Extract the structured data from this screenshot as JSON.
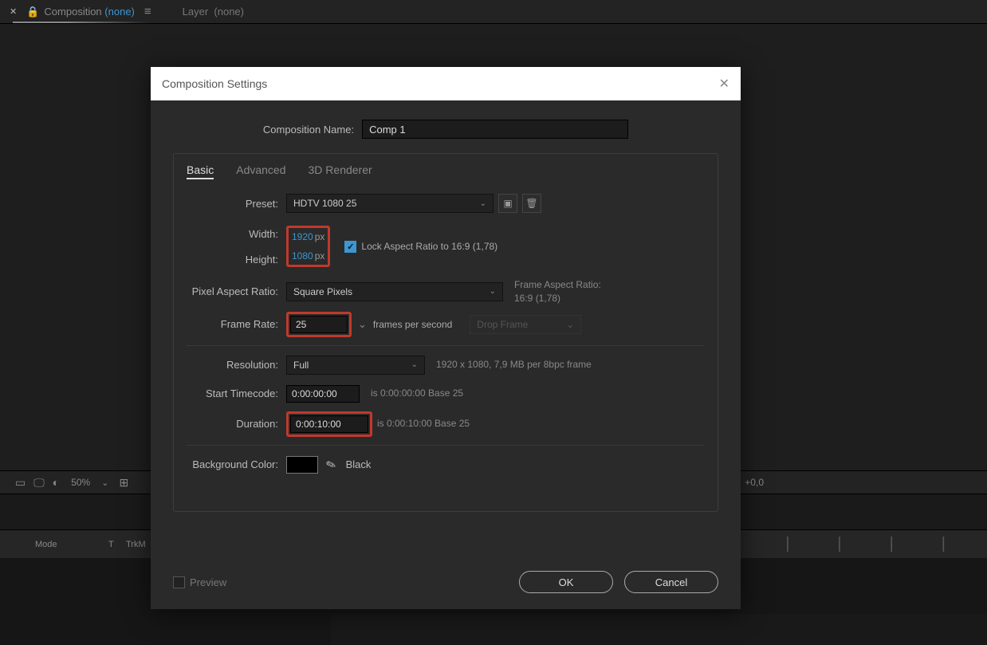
{
  "topbar": {
    "composition_label": "Composition",
    "composition_none": "(none)",
    "layer_label": "Layer",
    "layer_none": "(none)"
  },
  "toolbar": {
    "zoom": "50%",
    "plus_zero": "+0,0"
  },
  "timeline": {
    "mode": "Mode",
    "t": "T",
    "trkm": "TrkM"
  },
  "dialog": {
    "title": "Composition Settings",
    "comp_name_label": "Composition Name:",
    "comp_name": "Comp 1",
    "tabs": {
      "basic": "Basic",
      "advanced": "Advanced",
      "renderer": "3D Renderer"
    },
    "preset_label": "Preset:",
    "preset_value": "HDTV 1080 25",
    "width_label": "Width:",
    "width_value": "1920",
    "width_unit": "px",
    "height_label": "Height:",
    "height_value": "1080",
    "height_unit": "px",
    "lock_label": "Lock Aspect Ratio to 16:9 (1,78)",
    "par_label": "Pixel Aspect Ratio:",
    "par_value": "Square Pixels",
    "far_label": "Frame Aspect Ratio:",
    "far_value": "16:9 (1,78)",
    "fps_label": "Frame Rate:",
    "fps_value": "25",
    "fps_text": "frames per second",
    "drop_frame": "Drop Frame",
    "res_label": "Resolution:",
    "res_value": "Full",
    "res_info": "1920 x 1080, 7,9 MB per 8bpc frame",
    "start_tc_label": "Start Timecode:",
    "start_tc_value": "0:00:00:00",
    "start_tc_info": "is 0:00:00:00  Base 25",
    "duration_label": "Duration:",
    "duration_value": "0:00:10:00",
    "duration_info": "is 0:00:10:00  Base 25",
    "bg_label": "Background Color:",
    "bg_name": "Black",
    "preview": "Preview",
    "ok": "OK",
    "cancel": "Cancel"
  }
}
